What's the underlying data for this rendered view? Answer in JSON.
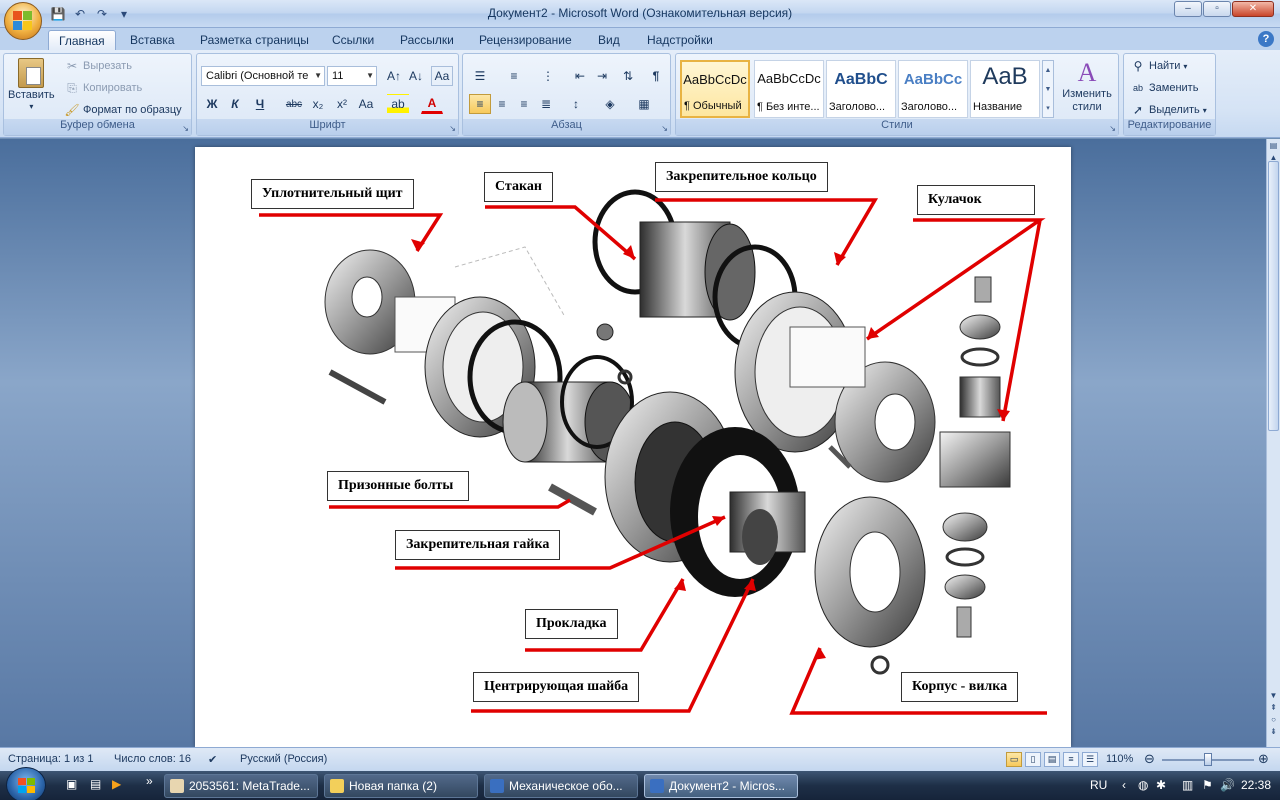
{
  "window": {
    "title": "Документ2 - Microsoft Word (Ознакомительная версия)",
    "controls": [
      "–",
      "▫",
      "✕"
    ]
  },
  "quick_access": [
    "save-icon",
    "undo-icon",
    "redo-icon",
    "customize-icon"
  ],
  "tabs": [
    {
      "label": "Главная",
      "active": true
    },
    {
      "label": "Вставка"
    },
    {
      "label": "Разметка страницы"
    },
    {
      "label": "Ссылки"
    },
    {
      "label": "Рассылки"
    },
    {
      "label": "Рецензирование"
    },
    {
      "label": "Вид"
    },
    {
      "label": "Надстройки"
    }
  ],
  "ribbon": {
    "clipboard": {
      "label": "Буфер обмена",
      "paste": "Вставить",
      "cut": "Вырезать",
      "copy": "Копировать",
      "format_painter": "Формат по образцу"
    },
    "font": {
      "label": "Шрифт",
      "font_name": "Calibri (Основной те",
      "font_size": "11",
      "buttons": [
        "A↑",
        "A↓",
        "Aa",
        "Ж",
        "К",
        "Ч",
        "abc",
        "x₂",
        "x²",
        "Aa",
        "ab",
        "A"
      ]
    },
    "paragraph": {
      "label": "Абзац"
    },
    "styles": {
      "label": "Стили",
      "items": [
        {
          "sample": "AaBbCcDc",
          "name": "¶ Обычный",
          "selected": true
        },
        {
          "sample": "AaBbCcDc",
          "name": "¶ Без инте..."
        },
        {
          "sample": "AaBbC",
          "name": "Заголово..."
        },
        {
          "sample": "AaBbCc",
          "name": "Заголово..."
        },
        {
          "sample": "AaB",
          "name": "Название"
        }
      ],
      "change_styles": "Изменить стили"
    },
    "editing": {
      "label": "Редактирование",
      "find": "Найти",
      "replace": "Заменить",
      "select": "Выделить"
    }
  },
  "figure_labels": {
    "seal_shield": "Уплотнительный щит",
    "cup": "Стакан",
    "retaining_ring": "Закрепительное кольцо",
    "cam": "Кулачок",
    "fitted_bolts": "Призонные болты",
    "retaining_nut": "Закрепительная гайка",
    "gasket": "Прокладка",
    "centering_washer": "Центрирующая шайба",
    "body_fork": "Корпус - вилка"
  },
  "statusbar": {
    "page": "Страница: 1 из 1",
    "words": "Число слов: 16",
    "language": "Русский (Россия)",
    "zoom": "110%"
  },
  "taskbar": {
    "tasks": [
      {
        "label": "2053561: MetaTrade..."
      },
      {
        "label": "Новая папка (2)"
      },
      {
        "label": "Механическое обо..."
      },
      {
        "label": "Документ2 - Micros...",
        "active": true
      }
    ],
    "lang": "RU",
    "clock": "22:38"
  },
  "colors": {
    "accent_red": "#e00000",
    "ribbon_blue": "#d5e3f5"
  }
}
